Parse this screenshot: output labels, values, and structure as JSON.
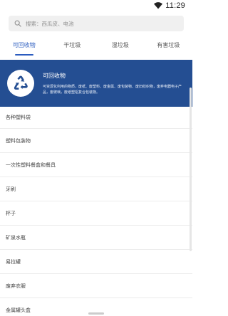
{
  "status": {
    "time": "11:29"
  },
  "search": {
    "placeholder": "搜索：西瓜皮、电池"
  },
  "tabs": [
    {
      "label": "可回收物",
      "active": true
    },
    {
      "label": "干垃圾",
      "active": false
    },
    {
      "label": "湿垃圾",
      "active": false
    },
    {
      "label": "有害垃圾",
      "active": false
    }
  ],
  "banner": {
    "icon": "recycle-icon",
    "title": "可回收物",
    "description": "可资源化利用的物质，废纸、废塑料、废金属、废包装物、废旧纺织物，废弃电器电子产品，废玻璃，废纸塑铝复合包装物。"
  },
  "items": [
    {
      "label": "各种塑料袋"
    },
    {
      "label": "塑料包装物"
    },
    {
      "label": "一次性塑料餐盒和餐具"
    },
    {
      "label": "牙刷"
    },
    {
      "label": "杯子"
    },
    {
      "label": "矿泉水瓶"
    },
    {
      "label": "易拉罐"
    },
    {
      "label": "废弃衣服"
    },
    {
      "label": "金属罐头盒"
    }
  ],
  "colors": {
    "accent": "#2b5cbf",
    "banner_bg": "#244e92"
  }
}
